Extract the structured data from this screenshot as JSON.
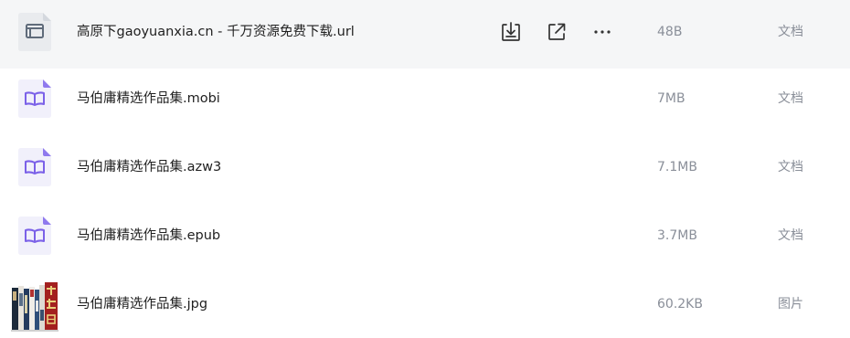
{
  "files": [
    {
      "name": "高原下gaoyuanxia.cn - 千万资源免费下载.url",
      "size": "48B",
      "type": "文档",
      "icon": "url-link-file-icon",
      "hovered": true
    },
    {
      "name": "马伯庸精选作品集.mobi",
      "size": "7MB",
      "type": "文档",
      "icon": "ebook-file-icon"
    },
    {
      "name": "马伯庸精选作品集.azw3",
      "size": "7.1MB",
      "type": "文档",
      "icon": "ebook-file-icon"
    },
    {
      "name": "马伯庸精选作品集.epub",
      "size": "3.7MB",
      "type": "文档",
      "icon": "ebook-file-icon"
    },
    {
      "name": "马伯庸精选作品集.jpg",
      "size": "60.2KB",
      "type": "图片",
      "icon": "image-thumbnail"
    }
  ],
  "row_actions": [
    {
      "name": "download",
      "icon": "download-icon"
    },
    {
      "name": "share",
      "icon": "share-external-icon"
    },
    {
      "name": "more",
      "icon": "more-horizontal-icon"
    }
  ],
  "colors": {
    "hover_row": "#f5f6f7",
    "ebook_accent": "#7b61e8",
    "ebook_bg": "#f1f0fb",
    "text_primary": "#1f1f1f",
    "text_secondary": "#8a8f99"
  }
}
